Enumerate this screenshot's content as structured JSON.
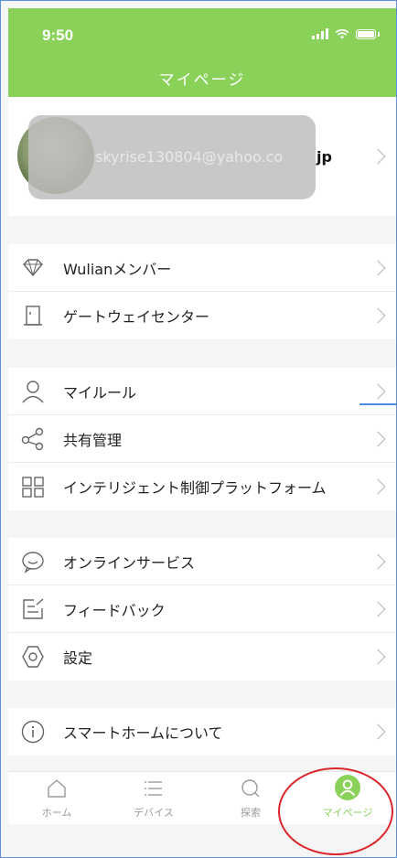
{
  "status_bar": {
    "time": "9:50"
  },
  "header": {
    "title": "マイページ"
  },
  "profile": {
    "email": "skyrise130804@yahoo.co",
    "email_tail": "jp"
  },
  "groups": [
    {
      "items": [
        {
          "label": "Wulianメンバー",
          "icon": "diamond-icon"
        },
        {
          "label": "ゲートウェイセンター",
          "icon": "door-icon"
        }
      ]
    },
    {
      "items": [
        {
          "label": "マイルール",
          "icon": "person-icon"
        },
        {
          "label": "共有管理",
          "icon": "share-icon"
        },
        {
          "label": "インテリジェント制御プラットフォーム",
          "icon": "grid-icon"
        }
      ]
    },
    {
      "items": [
        {
          "label": "オンラインサービス",
          "icon": "chat-bubble-icon"
        },
        {
          "label": "フィードバック",
          "icon": "feedback-icon"
        },
        {
          "label": "設定",
          "icon": "gear-icon"
        }
      ]
    },
    {
      "items": [
        {
          "label": "スマートホームについて",
          "icon": "info-icon"
        }
      ]
    }
  ],
  "tabbar": {
    "tabs": [
      {
        "label": "ホーム",
        "icon": "home-icon"
      },
      {
        "label": "デバイス",
        "icon": "list-icon"
      },
      {
        "label": "探索",
        "icon": "search-icon"
      },
      {
        "label": "マイページ",
        "icon": "profile-icon",
        "active": true
      }
    ]
  },
  "colors": {
    "accent": "#8ad15a",
    "highlight": "#d9262b",
    "underline": "#4a8fe0"
  }
}
